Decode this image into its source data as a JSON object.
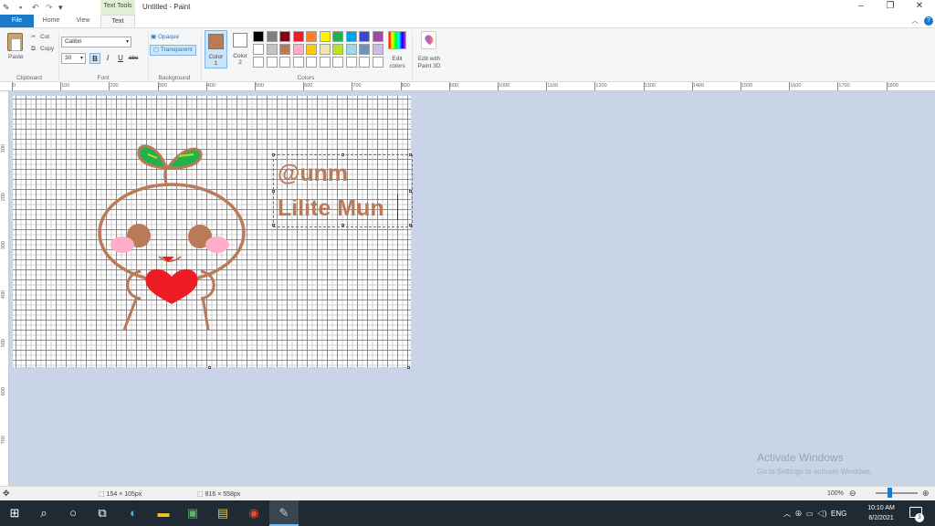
{
  "window": {
    "title": "Untitled - Paint",
    "contextual_tab": "Text Tools",
    "quick_access_icons": [
      "paint-app-icon",
      "save-icon",
      "undo-icon",
      "redo-icon",
      "dropdown-icon"
    ]
  },
  "tabs": {
    "file": "File",
    "home": "Home",
    "view": "View",
    "text": "Text"
  },
  "clipboard": {
    "paste": "Paste",
    "cut": "Cut",
    "copy": "Copy",
    "group": "Clipboard"
  },
  "font": {
    "family": "Calibri",
    "size": "30",
    "bold": "B",
    "italic": "I",
    "underline": "U",
    "strike": "abc",
    "group": "Font"
  },
  "background": {
    "opaque": "Opaque",
    "transparent": "Transparent",
    "group": "Background"
  },
  "colors": {
    "color1": "Color",
    "color1_num": "1",
    "color2": "Color",
    "color2_num": "2",
    "edit": "Edit",
    "edit2": "colors",
    "paint3d": "Edit with",
    "paint3d2": "Paint 3D",
    "group": "Colors",
    "color1_value": "#b97a57",
    "color2_value": "#ffffff",
    "palette_row1": [
      "#000000",
      "#7f7f7f",
      "#880015",
      "#ed1c24",
      "#ff7f27",
      "#fff200",
      "#22b14c",
      "#00a2e8",
      "#3f48cc",
      "#a349a4"
    ],
    "palette_row2": [
      "#ffffff",
      "#c3c3c3",
      "#b97a57",
      "#ffaec9",
      "#ffc90e",
      "#efe4b0",
      "#b5e61d",
      "#99d9ea",
      "#7092be",
      "#c8bfe7"
    ]
  },
  "ruler": {
    "h": [
      "0",
      "100",
      "200",
      "300",
      "400",
      "500",
      "600",
      "700",
      "800",
      "900",
      "1000",
      "1100",
      "1200",
      "1300",
      "1400",
      "1500",
      "1600",
      "1700",
      "1800"
    ],
    "v": [
      "100",
      "200",
      "300",
      "400",
      "500",
      "600",
      "700"
    ]
  },
  "canvas": {
    "text_line1": "@unm",
    "text_line2": "Lilite Mun",
    "text_color": "#b97a57"
  },
  "activate": {
    "title": "Activate Windows",
    "subtitle": "Go to Settings to activate Windows."
  },
  "status": {
    "selection": "154 × 105px",
    "image_size": "816 × 558px",
    "zoom": "100%"
  },
  "taskbar": {
    "time": "10:10 AM",
    "date": "6/2/2021",
    "lang": "ENG",
    "notifications": "3"
  }
}
